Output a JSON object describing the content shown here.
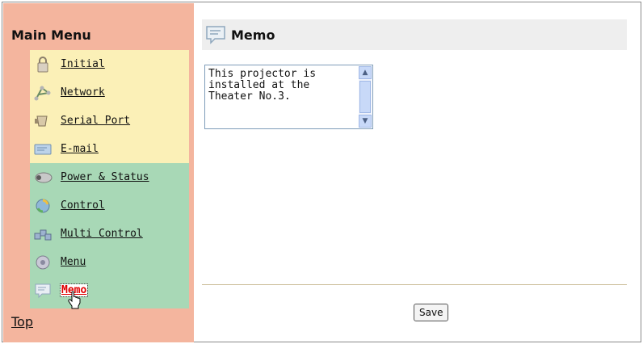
{
  "sidebar": {
    "title": "Main Menu",
    "items": [
      {
        "label": "Initial",
        "icon": "lock-icon"
      },
      {
        "label": "Network",
        "icon": "network-icon"
      },
      {
        "label": "Serial Port",
        "icon": "serial-port-icon"
      },
      {
        "label": "E-mail",
        "icon": "email-icon"
      },
      {
        "label": "Power & Status",
        "icon": "projector-icon"
      },
      {
        "label": "Control",
        "icon": "control-icon"
      },
      {
        "label": "Multi Control",
        "icon": "multi-control-icon"
      },
      {
        "label": "Menu",
        "icon": "menu-disc-icon"
      },
      {
        "label": "Memo",
        "icon": "memo-icon",
        "active": true
      }
    ],
    "top_link": "Top"
  },
  "main": {
    "title": "Memo",
    "memo_text": "This projector is\ninstalled at the\nTheater No.3.",
    "save_label": "Save"
  },
  "colors": {
    "sidebar_bg": "#f4b59e",
    "setup_group_bg": "#fbf0b7",
    "control_group_bg": "#a8d8b6",
    "active_label": "#e00000",
    "header_bg": "#eeeeee"
  }
}
